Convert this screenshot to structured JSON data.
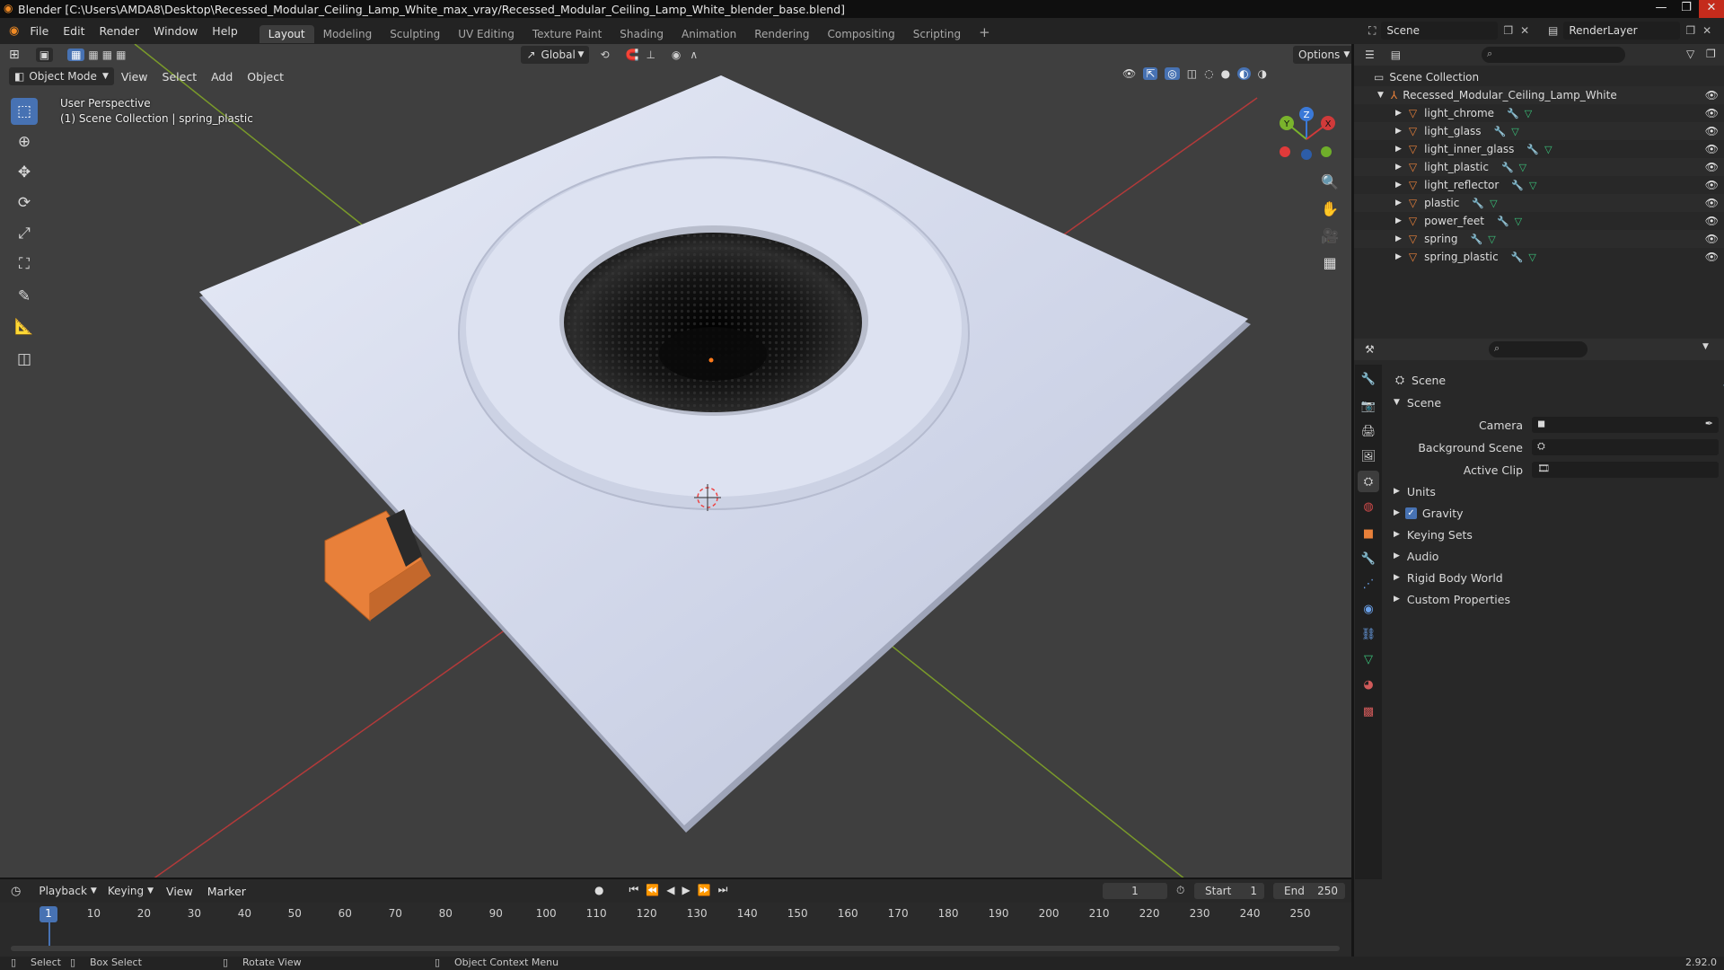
{
  "titlebar": {
    "title": "Blender [C:\\Users\\AMDA8\\Desktop\\Recessed_Modular_Ceiling_Lamp_White_max_vray/Recessed_Modular_Ceiling_Lamp_White_blender_base.blend]",
    "minimize": "—",
    "maximize": "❐",
    "close": "✕"
  },
  "menubar": {
    "menus": [
      "File",
      "Edit",
      "Render",
      "Window",
      "Help"
    ],
    "workspaces": [
      "Layout",
      "Modeling",
      "Sculpting",
      "UV Editing",
      "Texture Paint",
      "Shading",
      "Animation",
      "Rendering",
      "Compositing",
      "Scripting"
    ],
    "add_workspace": "+",
    "scene_name": "Scene",
    "view_layer": "RenderLayer"
  },
  "viewport": {
    "orientation": "Global",
    "options_label": "Options",
    "mode": "Object Mode",
    "menus": [
      "View",
      "Select",
      "Add",
      "Object"
    ],
    "overlay_line1": "User Perspective",
    "overlay_line2": "(1) Scene Collection | spring_plastic",
    "gizmo_axes": {
      "x": "X",
      "y": "Y",
      "z": "Z"
    }
  },
  "outliner": {
    "root": "Scene Collection",
    "collection": "Recessed_Modular_Ceiling_Lamp_White",
    "objects": [
      "light_chrome",
      "light_glass",
      "light_inner_glass",
      "light_plastic",
      "light_reflector",
      "plastic",
      "power_feet",
      "spring",
      "spring_plastic"
    ]
  },
  "properties": {
    "context_title": "Scene",
    "panel_title": "Scene",
    "camera_label": "Camera",
    "background_scene_label": "Background Scene",
    "active_clip_label": "Active Clip",
    "subpanels": [
      "Units",
      "Gravity",
      "Keying Sets",
      "Audio",
      "Rigid Body World",
      "Custom Properties"
    ],
    "gravity_checked": true
  },
  "timeline": {
    "menus": [
      "Playback",
      "Keying",
      "View",
      "Marker"
    ],
    "current_frame": "1",
    "start_label": "Start",
    "start_value": "1",
    "end_label": "End",
    "end_value": "250",
    "ticks": [
      "1",
      "10",
      "20",
      "30",
      "40",
      "50",
      "60",
      "70",
      "80",
      "90",
      "100",
      "110",
      "120",
      "130",
      "140",
      "150",
      "160",
      "170",
      "180",
      "190",
      "200",
      "210",
      "220",
      "230",
      "240",
      "250"
    ]
  },
  "statusbar": {
    "select": "Select",
    "box_select": "Box Select",
    "rotate_view": "Rotate View",
    "context_menu": "Object Context Menu",
    "version": "2.92.0"
  },
  "colors": {
    "accent": "#4772b3",
    "object_orange": "#e8803a",
    "axis_red": "#d03a3a",
    "axis_green": "#7ab32c"
  }
}
